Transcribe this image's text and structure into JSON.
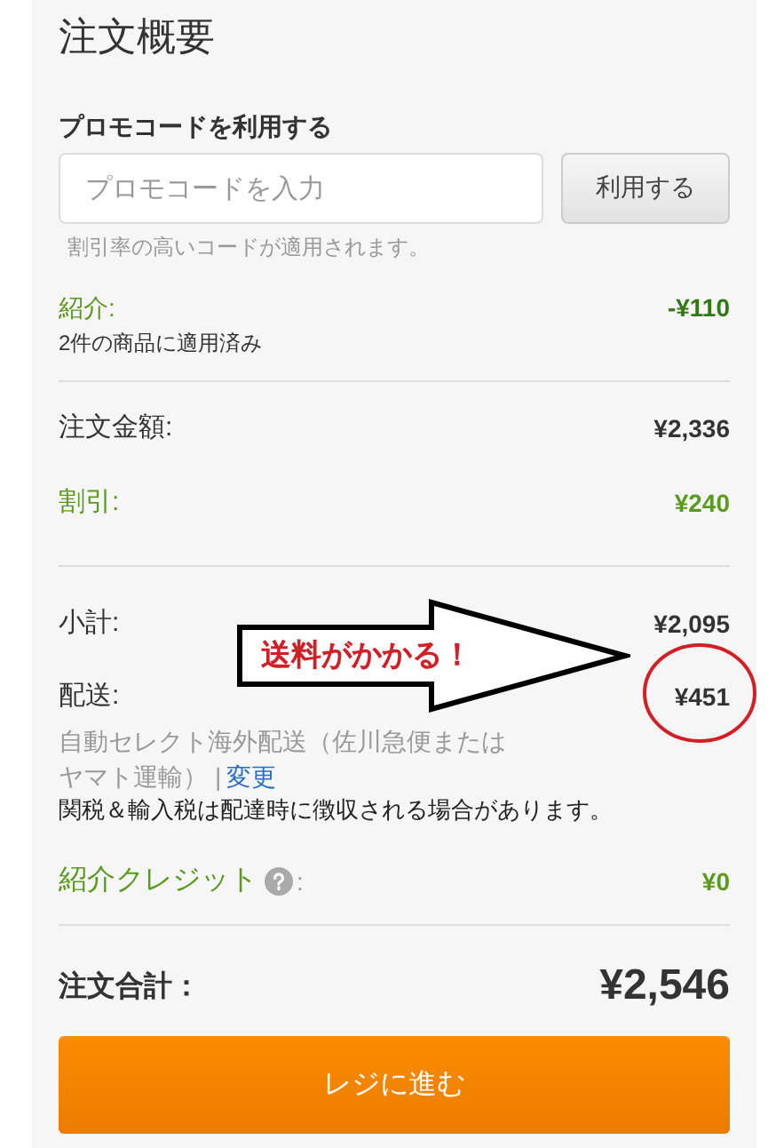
{
  "title": "注文概要",
  "promo": {
    "label": "プロモコードを利用する",
    "placeholder": "プロモコードを入力",
    "button": "利用する",
    "hint": "割引率の高いコードが適用されます。"
  },
  "referral": {
    "label": "紹介:",
    "note": "2件の商品に適用済み",
    "amount": "-¥110"
  },
  "lines": [
    {
      "label": "注文金額:",
      "amount": "¥2,336",
      "color": "#333333"
    },
    {
      "label": "割引:",
      "amount": "¥240",
      "color": "#5a9a1e"
    }
  ],
  "subtotal": {
    "label": "小計:",
    "amount": "¥2,095"
  },
  "shipping": {
    "label": "配送:",
    "amount": "¥451",
    "method_lines": [
      "自動セレクト海外配送（佐川急便または",
      "ヤマト運輸）"
    ],
    "separator": "|",
    "link": "変更",
    "notice": "関税＆輸入税は配達時に徴収される場合があります。"
  },
  "credit": {
    "label": "紹介クレジット",
    "colon": ":",
    "amount": "¥0"
  },
  "total": {
    "label": "注文合計：",
    "amount": "¥2,546"
  },
  "checkout_button": "レジに進む",
  "annotation": {
    "text": "送料がかかる！"
  }
}
